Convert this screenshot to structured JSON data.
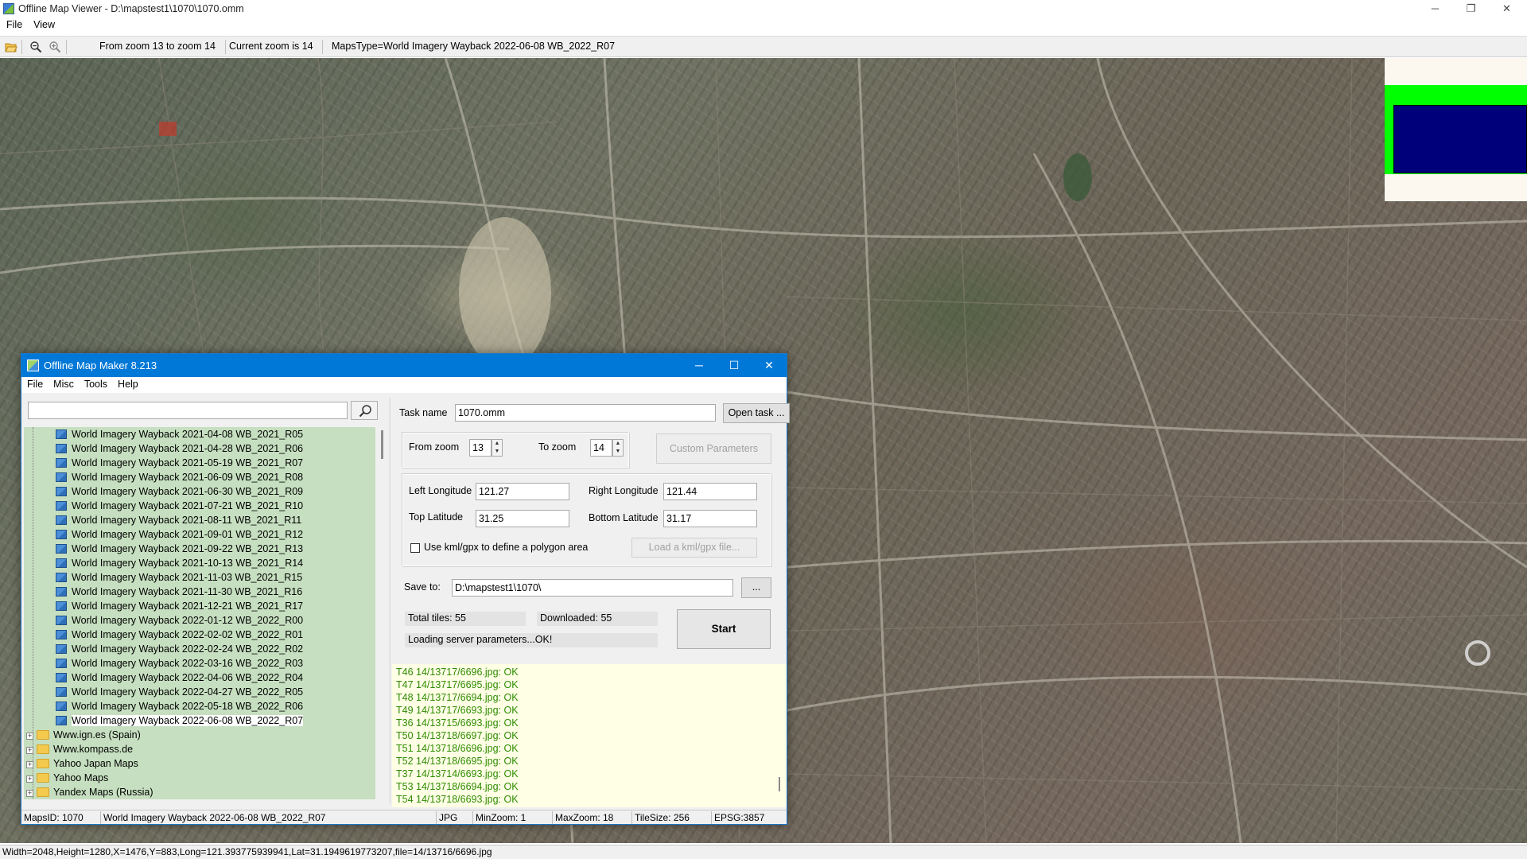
{
  "window": {
    "title": "Offline Map Viewer - D:\\mapstest1\\1070\\1070.omm",
    "minimize": "─",
    "restore": "❐",
    "close": "✕"
  },
  "main_menu": [
    "File",
    "View"
  ],
  "toolbar": {
    "zoom_range": "From zoom 13 to zoom 14",
    "current_zoom": "Current zoom is 14",
    "maps_type": "MapsType=World Imagery Wayback 2022-06-08 WB_2022_R07"
  },
  "statusbar": {
    "text": "Width=2048,Height=1280,X=1476,Y=883,Long=121.393775939941,Lat=31.1949619773207,file=14/13716/6696.jpg"
  },
  "colors": {
    "overview_band": "#00ff00",
    "overview_view": "#00007a",
    "title_bar": "#0078d7",
    "tree_bg": "#c6dfc0",
    "log_text": "#2e8b00"
  },
  "dialog": {
    "title": "Offline Map Maker 8.213",
    "minimize": "─",
    "maximize": "☐",
    "close": "✕",
    "menu": [
      "File",
      "Misc",
      "Tools",
      "Help"
    ],
    "search": {
      "value": "",
      "icon": "search-icon"
    },
    "tree_items": [
      "World Imagery Wayback 2021-04-08 WB_2021_R05",
      "World Imagery Wayback 2021-04-28 WB_2021_R06",
      "World Imagery Wayback 2021-05-19 WB_2021_R07",
      "World Imagery Wayback 2021-06-09 WB_2021_R08",
      "World Imagery Wayback 2021-06-30 WB_2021_R09",
      "World Imagery Wayback 2021-07-21 WB_2021_R10",
      "World Imagery Wayback 2021-08-11 WB_2021_R11",
      "World Imagery Wayback 2021-09-01 WB_2021_R12",
      "World Imagery Wayback 2021-09-22 WB_2021_R13",
      "World Imagery Wayback 2021-10-13 WB_2021_R14",
      "World Imagery Wayback 2021-11-03 WB_2021_R15",
      "World Imagery Wayback 2021-11-30 WB_2021_R16",
      "World Imagery Wayback 2021-12-21 WB_2021_R17",
      "World Imagery Wayback 2022-01-12 WB_2022_R00",
      "World Imagery Wayback 2022-02-02 WB_2022_R01",
      "World Imagery Wayback 2022-02-24 WB_2022_R02",
      "World Imagery Wayback 2022-03-16 WB_2022_R03",
      "World Imagery Wayback 2022-04-06 WB_2022_R04",
      "World Imagery Wayback 2022-04-27 WB_2022_R05",
      "World Imagery Wayback 2022-05-18 WB_2022_R06",
      "World Imagery Wayback 2022-06-08 WB_2022_R07"
    ],
    "selected_item": "World Imagery Wayback 2022-06-08 WB_2022_R07",
    "tree_folders": [
      "Www.ign.es (Spain)",
      "Www.kompass.de",
      "Yahoo Japan Maps",
      "Yahoo Maps",
      "Yandex Maps (Russia)"
    ],
    "task_name_label": "Task name",
    "task_name_value": "1070.omm",
    "open_task_button": "Open task ...",
    "from_zoom_label": "From zoom",
    "from_zoom_value": "13",
    "to_zoom_label": "To zoom",
    "to_zoom_value": "14",
    "custom_parameters_button": "Custom Parameters",
    "left_longitude_label": "Left Longitude",
    "left_longitude_value": "121.27",
    "right_longitude_label": "Right Longitude",
    "right_longitude_value": "121.44",
    "top_latitude_label": "Top Latitude",
    "top_latitude_value": "31.25",
    "bottom_latitude_label": "Bottom Latitude",
    "bottom_latitude_value": "31.17",
    "use_kml_label": "Use kml/gpx to define a polygon area",
    "use_kml_checked": false,
    "load_kml_button": "Load a kml/gpx file...",
    "save_to_label": "Save to:",
    "save_to_value": "D:\\mapstest1\\1070\\",
    "browse_button": "...",
    "total_tiles": "Total tiles: 55",
    "downloaded": "Downloaded: 55",
    "start_button": "Start",
    "server_status": "Loading server parameters...OK!",
    "log_lines": [
      "T46 14/13717/6696.jpg: OK",
      "T47 14/13717/6695.jpg: OK",
      "T48 14/13717/6694.jpg: OK",
      "T49 14/13717/6693.jpg: OK",
      "T36 14/13715/6693.jpg: OK",
      "T50 14/13718/6697.jpg: OK",
      "T51 14/13718/6696.jpg: OK",
      "T52 14/13718/6695.jpg: OK",
      "T37 14/13714/6693.jpg: OK",
      "T53 14/13718/6694.jpg: OK",
      "T54 14/13718/6693.jpg: OK"
    ],
    "status_cells": [
      "MapsID: 1070",
      "World Imagery Wayback 2022-06-08 WB_2022_R07",
      "JPG",
      "MinZoom: 1",
      "MaxZoom: 18",
      "TileSize: 256",
      "EPSG:3857"
    ]
  }
}
